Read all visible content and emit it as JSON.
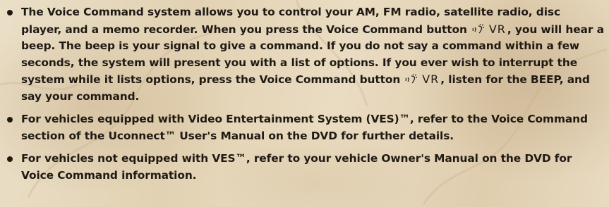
{
  "items": [
    {
      "segments": [
        "The Voice Command system allows you to control your AM, FM radio, satellite radio, disc player, and a memo recorder. When you press the Voice Command button",
        ", you will hear a beep. The beep is your signal to give a command. If you do not say a command within a few seconds, the system will present you with a list of options. If you ever wish to interrupt the system while it lists options, press the Voice Command button",
        ", listen for the BEEP, and say your command."
      ]
    },
    {
      "segments": [
        "For vehicles equipped with Video Entertainment System (VES)™, refer to the Voice Command section of the Uconnect™ User's Manual on the DVD for further details."
      ]
    },
    {
      "segments": [
        "For vehicles not equipped with VES™, refer to your vehicle Owner's Manual on the DVD for Voice Command information."
      ]
    }
  ],
  "vr_button": {
    "icon": "voice-command-icon",
    "label": "VR"
  }
}
